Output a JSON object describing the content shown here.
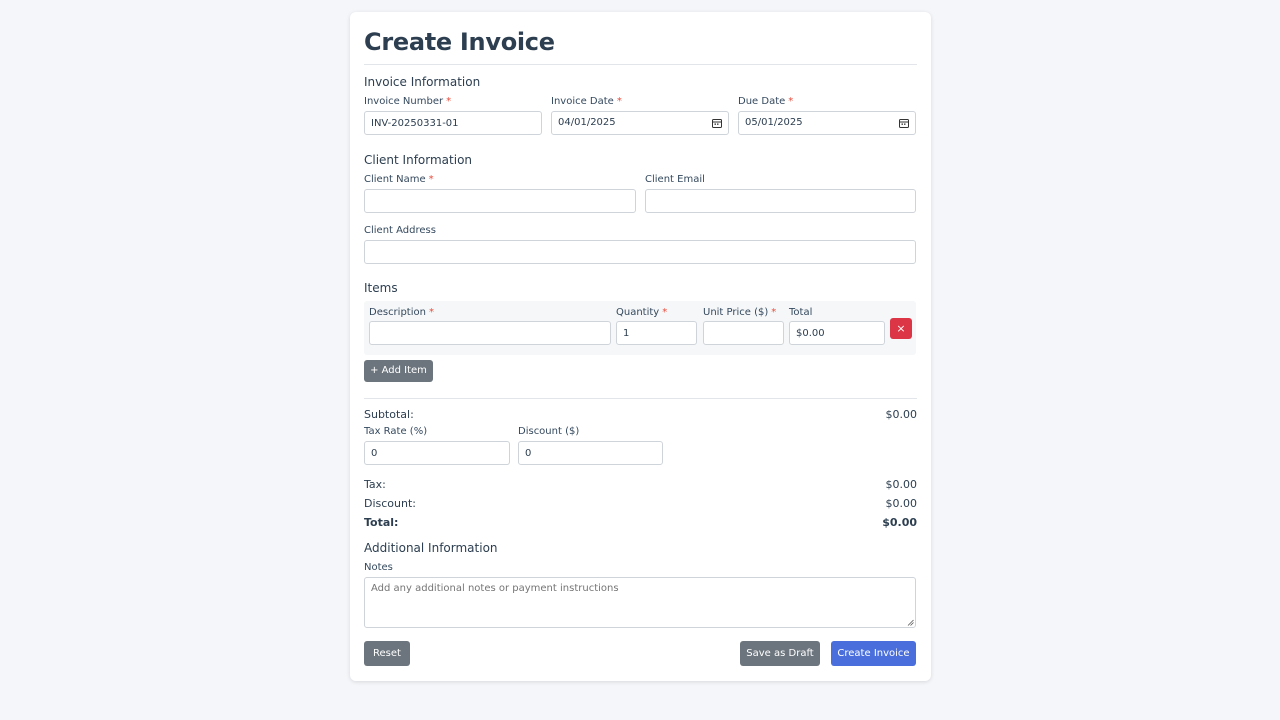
{
  "title": "Create Invoice",
  "invoice_section": {
    "heading": "Invoice Information",
    "number_label": "Invoice Number",
    "number_value": "INV-20250331-01",
    "date_label": "Invoice Date",
    "date_value": "04/01/2025",
    "due_label": "Due Date",
    "due_value": "05/01/2025",
    "required_mark": "*"
  },
  "client_section": {
    "heading": "Client Information",
    "name_label": "Client Name",
    "name_value": "",
    "email_label": "Client Email",
    "email_value": "",
    "address_label": "Client Address",
    "address_value": ""
  },
  "items_section": {
    "heading": "Items",
    "col_description": "Description",
    "col_quantity": "Quantity",
    "col_unit_price": "Unit Price ($)",
    "col_total": "Total",
    "rows": [
      {
        "description": "",
        "quantity": "1",
        "unit_price": "",
        "total": "$0.00"
      }
    ],
    "remove_label": "×",
    "add_label": "+ Add Item"
  },
  "totals": {
    "subtotal_label": "Subtotal:",
    "subtotal_value": "$0.00",
    "tax_rate_label": "Tax Rate (%)",
    "tax_rate_value": "0",
    "discount_input_label": "Discount ($)",
    "discount_input_value": "0",
    "tax_label": "Tax:",
    "tax_value": "$0.00",
    "discount_label": "Discount:",
    "discount_value": "$0.00",
    "total_label": "Total:",
    "total_value": "$0.00"
  },
  "additional": {
    "heading": "Additional Information",
    "notes_label": "Notes",
    "notes_placeholder": "Add any additional notes or payment instructions"
  },
  "actions": {
    "reset_label": "Reset",
    "draft_label": "Save as Draft",
    "create_label": "Create Invoice"
  },
  "colors": {
    "primary": "#4a6fdc",
    "secondary": "#6c757d",
    "danger": "#dc3545",
    "required": "#e74c3c"
  }
}
